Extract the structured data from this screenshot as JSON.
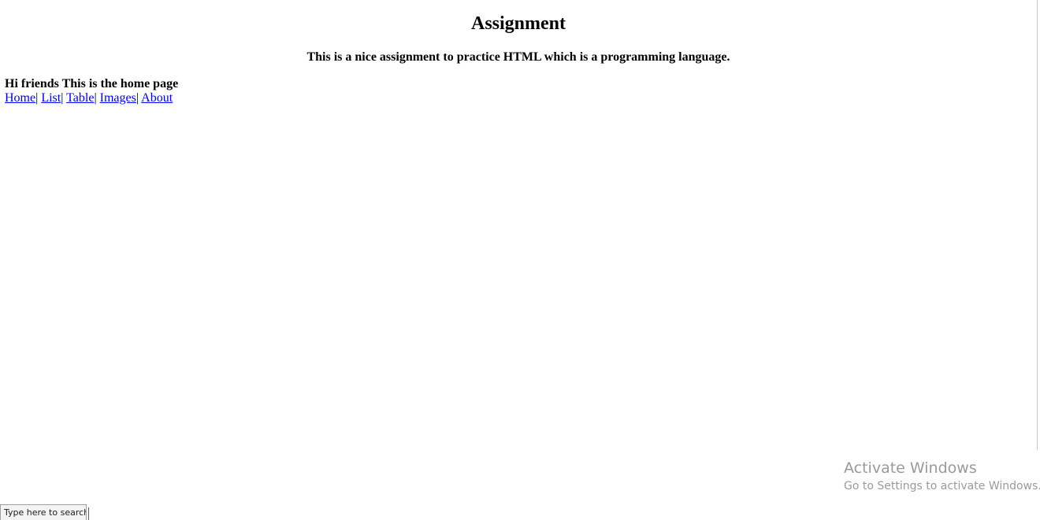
{
  "page": {
    "title": "Assignment",
    "subtitle": "This is a nice assignment to practice HTML which is a programming language.",
    "greeting": "Hi friends This is the home page"
  },
  "nav": {
    "separator": "|",
    "items": [
      {
        "label": "Home"
      },
      {
        "label": "List"
      },
      {
        "label": "Table"
      },
      {
        "label": "Images"
      },
      {
        "label": "About"
      }
    ]
  },
  "watermark": {
    "title": "Activate Windows",
    "subtitle": "Go to Settings to activate Windows."
  },
  "taskbar": {
    "search_placeholder": "Type here to search"
  }
}
